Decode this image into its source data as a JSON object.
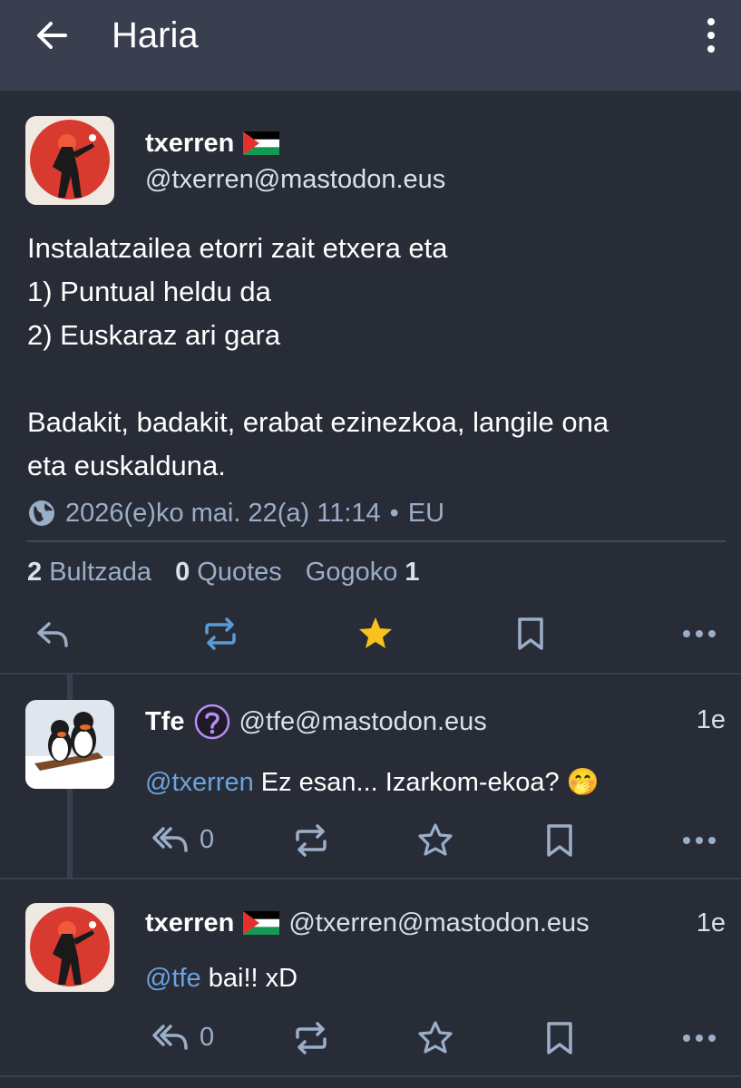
{
  "app_bar": {
    "title": "Haria",
    "back_icon": "arrow-left-icon",
    "menu_icon": "more-vertical-icon"
  },
  "main_post": {
    "display_name": "txerren",
    "flag": "🇵🇸",
    "handle": "@txerren@mastodon.eus",
    "content_lines": [
      "Instalatzailea etorri zait etxera eta",
      "1) Puntual heldu da",
      "2) Euskaraz ari gara",
      "",
      "Badakit, badakit, erabat ezinezkoa, langile ona",
      "eta euskalduna."
    ],
    "timestamp": "2026(e)ko mai. 22(a) 11:14",
    "language": "EU",
    "visibility_icon": "globe-icon",
    "stats": {
      "boosts_count": "2",
      "boosts_label": "Bultzada",
      "quotes_count": "0",
      "quotes_label": "Quotes",
      "favourites_label": "Gogoko",
      "favourites_count": "1"
    },
    "boosted_color": "#5b9bd5",
    "favourited_color": "#f9c11c"
  },
  "replies": [
    {
      "display_name": "Tfe",
      "badge_icon": "question-mark-icon",
      "handle": "@tfe@mastodon.eus",
      "time": "1e",
      "mention": "@txerren",
      "text": " Ez esan... Izarkom-ekoa? 🤭",
      "reply_count": "0"
    },
    {
      "display_name": "txerren",
      "flag": "🇵🇸",
      "handle": "@txerren@mastodon.eus",
      "time": "1e",
      "mention": "@tfe",
      "text": " bai!! xD",
      "reply_count": "0"
    }
  ]
}
